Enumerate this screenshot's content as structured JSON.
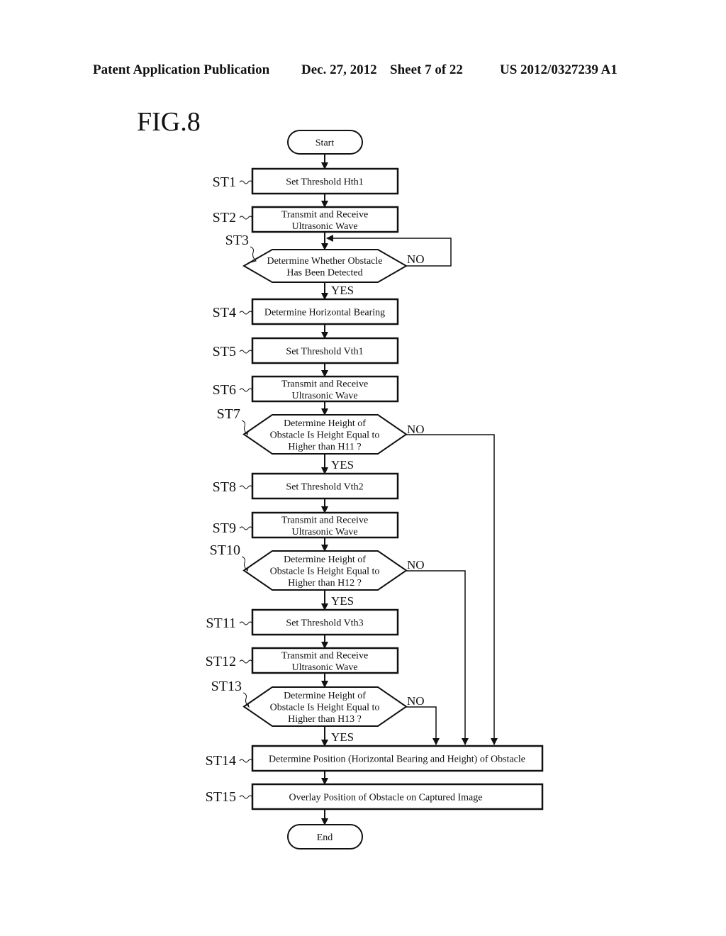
{
  "header": {
    "publication": "Patent Application Publication",
    "date": "Dec. 27, 2012",
    "sheet": "Sheet 7 of 22",
    "number": "US 2012/0327239 A1"
  },
  "figure": {
    "title": "FIG.8",
    "start": "Start",
    "end": "End",
    "yes": "YES",
    "no": "NO",
    "steps": [
      {
        "id": "ST1",
        "type": "process",
        "lines": [
          "Set Threshold Hth1"
        ]
      },
      {
        "id": "ST2",
        "type": "process",
        "lines": [
          "Transmit and Receive",
          "Ultrasonic Wave"
        ]
      },
      {
        "id": "ST3",
        "type": "decision",
        "lines": [
          "Determine Whether Obstacle",
          "Has Been Detected"
        ]
      },
      {
        "id": "ST4",
        "type": "process",
        "lines": [
          "Determine Horizontal Bearing"
        ]
      },
      {
        "id": "ST5",
        "type": "process",
        "lines": [
          "Set Threshold Vth1"
        ]
      },
      {
        "id": "ST6",
        "type": "process",
        "lines": [
          "Transmit and Receive",
          "Ultrasonic Wave"
        ]
      },
      {
        "id": "ST7",
        "type": "decision",
        "lines": [
          "Determine Height of",
          "Obstacle Is Height Equal to",
          "Higher than H11 ?"
        ]
      },
      {
        "id": "ST8",
        "type": "process",
        "lines": [
          "Set Threshold Vth2"
        ]
      },
      {
        "id": "ST9",
        "type": "process",
        "lines": [
          "Transmit and Receive",
          "Ultrasonic Wave"
        ]
      },
      {
        "id": "ST10",
        "type": "decision",
        "lines": [
          "Determine Height of",
          "Obstacle Is Height Equal to",
          "Higher than H12 ?"
        ]
      },
      {
        "id": "ST11",
        "type": "process",
        "lines": [
          "Set Threshold Vth3"
        ]
      },
      {
        "id": "ST12",
        "type": "process",
        "lines": [
          "Transmit and Receive",
          "Ultrasonic Wave"
        ]
      },
      {
        "id": "ST13",
        "type": "decision",
        "lines": [
          "Determine Height of",
          "Obstacle Is Height Equal to",
          "Higher than H13 ?"
        ]
      },
      {
        "id": "ST14",
        "type": "process",
        "lines": [
          "Determine Position (Horizontal Bearing and Height) of Obstacle"
        ]
      },
      {
        "id": "ST15",
        "type": "process",
        "lines": [
          "Overlay Position of Obstacle on Captured Image"
        ]
      }
    ]
  }
}
